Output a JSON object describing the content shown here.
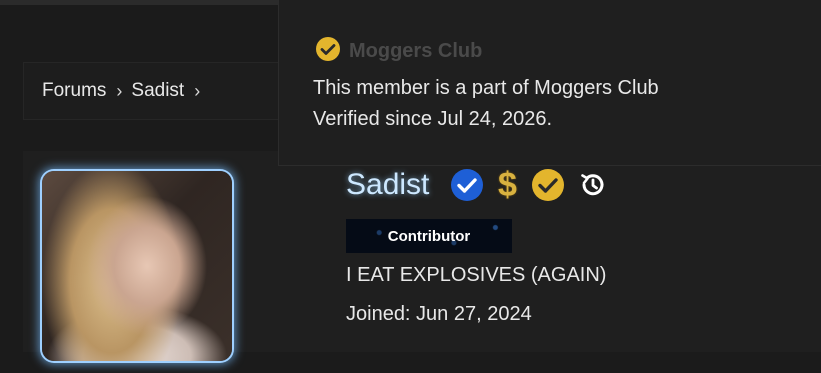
{
  "breadcrumb": {
    "items": [
      {
        "label": "Forums"
      },
      {
        "label": "Sadist"
      }
    ]
  },
  "profile": {
    "username": "Sadist",
    "role_banner": "Contributor",
    "custom_title": "I EAT EXPLOSIVES (AGAIN)",
    "joined": "Joined: Jun 27, 2024",
    "badges": {
      "dollar": "$"
    },
    "icons": [
      "verified-check-icon",
      "dollar-icon",
      "gold-check-icon",
      "history-icon"
    ]
  },
  "tooltip": {
    "title": "Moggers Club",
    "line1": "This member is a part of Moggers Club",
    "line2": "Verified since Jul 24, 2026."
  },
  "colors": {
    "background": "#1b1b1b",
    "panel": "#1f1f1f",
    "username": "#cde8ff",
    "verified_blue": "#1e5fd6",
    "gold": "#e3b52d"
  }
}
